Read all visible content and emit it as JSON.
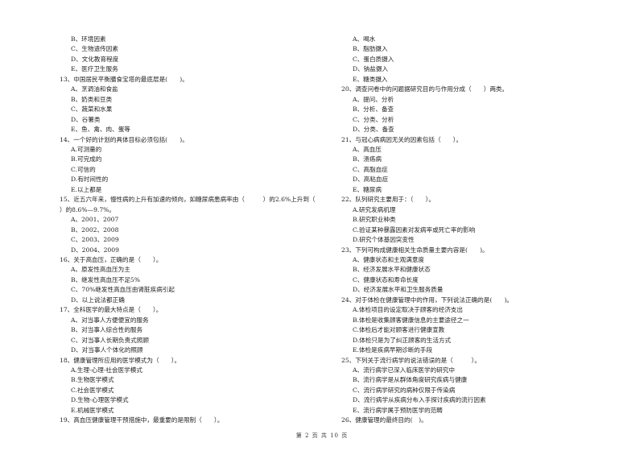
{
  "left_column": [
    {
      "type": "opt",
      "text": "B、环境因素"
    },
    {
      "type": "opt",
      "text": "C、生物遗传因素"
    },
    {
      "type": "opt",
      "text": "D、文化教育程度"
    },
    {
      "type": "opt",
      "text": "E、医疗卫生服务"
    },
    {
      "type": "q",
      "text": "13、中国居民平衡膳食宝塔的最底层是(　　)。"
    },
    {
      "type": "opt",
      "text": "A、烹调油和食盐"
    },
    {
      "type": "opt",
      "text": "B、奶类和豆类"
    },
    {
      "type": "opt",
      "text": "C、蔬菜和水果"
    },
    {
      "type": "opt",
      "text": "D、谷薯类"
    },
    {
      "type": "opt",
      "text": "E、鱼、禽、肉、蛋等"
    },
    {
      "type": "q",
      "text": "14、一个好的计划的具体目标必须包括(　　)。"
    },
    {
      "type": "opt",
      "text": "A.可测量的"
    },
    {
      "type": "opt",
      "text": "B.可完成的"
    },
    {
      "type": "opt",
      "text": "C.可信的"
    },
    {
      "type": "opt",
      "text": "D.有时间性的"
    },
    {
      "type": "opt",
      "text": "E.以上都是"
    },
    {
      "type": "q",
      "text": "15、近五六年来，慢性病的上升有加速的倾向，如糖尿病患病率由（　　　）的2.6%上升到（"
    },
    {
      "type": "cont",
      "text": "）的8.6%—9.7%。"
    },
    {
      "type": "opt",
      "text": "A、2001、2007"
    },
    {
      "type": "opt",
      "text": "B、2002、2008"
    },
    {
      "type": "opt",
      "text": "C、2003、2009"
    },
    {
      "type": "opt",
      "text": "D、2004、2009"
    },
    {
      "type": "q",
      "text": "16、关于高血压，正确的是（　　）。"
    },
    {
      "type": "opt",
      "text": "A、原发性高血压为主"
    },
    {
      "type": "opt",
      "text": "B、继发性高血压不足5%"
    },
    {
      "type": "opt",
      "text": "C、70%继发性高血压由肾脏疾病引起"
    },
    {
      "type": "opt",
      "text": "D、以上说法都正确"
    },
    {
      "type": "q",
      "text": "17、全科医学的最大特点是（　　）。"
    },
    {
      "type": "opt",
      "text": "A、对当事人方便便宜的服务"
    },
    {
      "type": "opt",
      "text": "B、对当事人综合性的服务"
    },
    {
      "type": "opt",
      "text": "C、对当事人长期负责式照顾"
    },
    {
      "type": "opt",
      "text": "D、对当事人个体化的照顾"
    },
    {
      "type": "q",
      "text": "18、健康管理所应用的医学模式为（　　）。"
    },
    {
      "type": "opt",
      "text": "A.生理-心理-社会医学模式"
    },
    {
      "type": "opt",
      "text": "B.生物医学模式"
    },
    {
      "type": "opt",
      "text": "C.社会医学模式"
    },
    {
      "type": "opt",
      "text": "D.生物-心理医学模式"
    },
    {
      "type": "opt",
      "text": "E.机械医学模式"
    },
    {
      "type": "q",
      "text": "19、高血压健康管理干预措施中，最重要的是限制（　　）。"
    }
  ],
  "right_column": [
    {
      "type": "opt",
      "text": "A、喝水"
    },
    {
      "type": "opt",
      "text": "B、脂肪摄入"
    },
    {
      "type": "opt",
      "text": "C、蛋白质摄入"
    },
    {
      "type": "opt",
      "text": "D、钠盐摄入"
    },
    {
      "type": "opt",
      "text": "E、糖类摄入"
    },
    {
      "type": "q",
      "text": "20、调查问卷中的问题据研究目的与作用分成（　　）两类。"
    },
    {
      "type": "opt",
      "text": "A、提问、分析"
    },
    {
      "type": "opt",
      "text": "B、分析、备查"
    },
    {
      "type": "opt",
      "text": "C、分类、分析"
    },
    {
      "type": "opt",
      "text": "D、分类、备查"
    },
    {
      "type": "q",
      "text": "21、与冠心病病因无关的因素包括（　　）。"
    },
    {
      "type": "opt",
      "text": "A、高血压"
    },
    {
      "type": "opt",
      "text": "B、溃疡病"
    },
    {
      "type": "opt",
      "text": "C、高脂血症"
    },
    {
      "type": "opt",
      "text": "D、高粘血症"
    },
    {
      "type": "opt",
      "text": "E、糖尿病"
    },
    {
      "type": "q",
      "text": "22、队列研究主要用于：（　　）。"
    },
    {
      "type": "opt",
      "text": "A.研究发病机理"
    },
    {
      "type": "opt",
      "text": "B.研究职业种类"
    },
    {
      "type": "opt",
      "text": "C.验证某种暴露因素对发病率或死亡率的影响"
    },
    {
      "type": "opt",
      "text": "D.研究个体基因突变性"
    },
    {
      "type": "q",
      "text": "23、下列可构成健康相关生命质量主要内容是(　　)。"
    },
    {
      "type": "opt",
      "text": "A、健康状态和主观满意度"
    },
    {
      "type": "opt",
      "text": "B、经济发展水平和健康状态"
    },
    {
      "type": "opt",
      "text": "C、健康状态和寿命长度"
    },
    {
      "type": "opt",
      "text": "D、经济发展水平和卫生服务质量"
    },
    {
      "type": "q",
      "text": "24、对于体检在健康管理中的作用，下列说法正确的是(　　)。"
    },
    {
      "type": "opt",
      "text": "A.体检项目的设定取决于顾客的经济支出"
    },
    {
      "type": "opt",
      "text": "B.体检是收集顾客健康信息的主要途径之一"
    },
    {
      "type": "opt",
      "text": "C.体检后才能对顾客进行健康宣教"
    },
    {
      "type": "opt",
      "text": "D.体检只是为了纠正顾客的生活方式"
    },
    {
      "type": "opt",
      "text": "E.体检是疾病早期诊断的手段"
    },
    {
      "type": "q",
      "text": "25、下列关于流行病学的说法错误的是（　　　）。"
    },
    {
      "type": "opt",
      "text": "A、流行病学已深入临床医学的研究中"
    },
    {
      "type": "opt",
      "text": "B、流行病学是从群体角度研究疾病与健康"
    },
    {
      "type": "opt",
      "text": "C、流行病学研究的病种仅限于传染病"
    },
    {
      "type": "opt",
      "text": "D、流行病学从疾病分布入手探讨疾病的流行因素"
    },
    {
      "type": "opt",
      "text": "E、流行病学属于预防医学的范畴"
    },
    {
      "type": "q",
      "text": "26、健康管理的最终目的(　)。"
    }
  ],
  "footer": {
    "page_label": "第 2 页 共 10 页"
  }
}
